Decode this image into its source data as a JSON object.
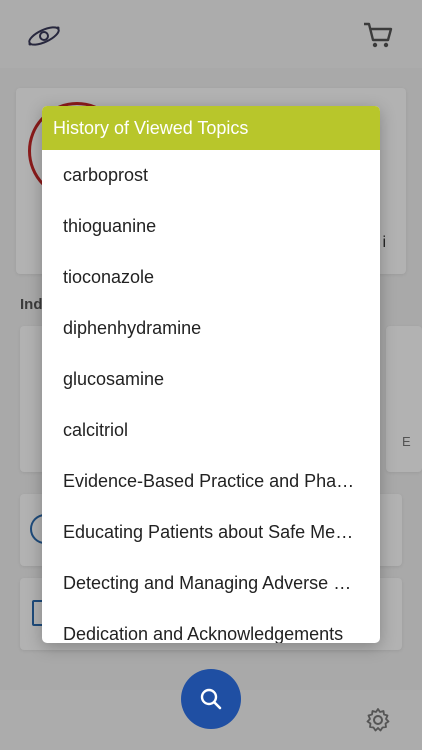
{
  "dialog": {
    "title": "History of Viewed Topics",
    "topics": [
      "carboprost",
      "thioguanine",
      "tioconazole",
      "diphenhydramine",
      "glucosamine",
      "calcitriol",
      "Evidence-Based Practice and Pharmacotherapeutics",
      "Educating Patients about Safe Medication Use",
      "Detecting and Managing Adverse Drug Reactions",
      "Dedication and Acknowledgements"
    ]
  },
  "background": {
    "section_label": "Ind",
    "hero_partial_text": "i",
    "tile_partial_text": "E"
  },
  "colors": {
    "header": "#b8c62b",
    "fab": "#1f4fa3",
    "accent_red": "#c62828"
  },
  "icons": {
    "logo": "galaxy-logo-icon",
    "cart": "cart-icon",
    "search": "search-icon",
    "settings": "gear-icon"
  }
}
